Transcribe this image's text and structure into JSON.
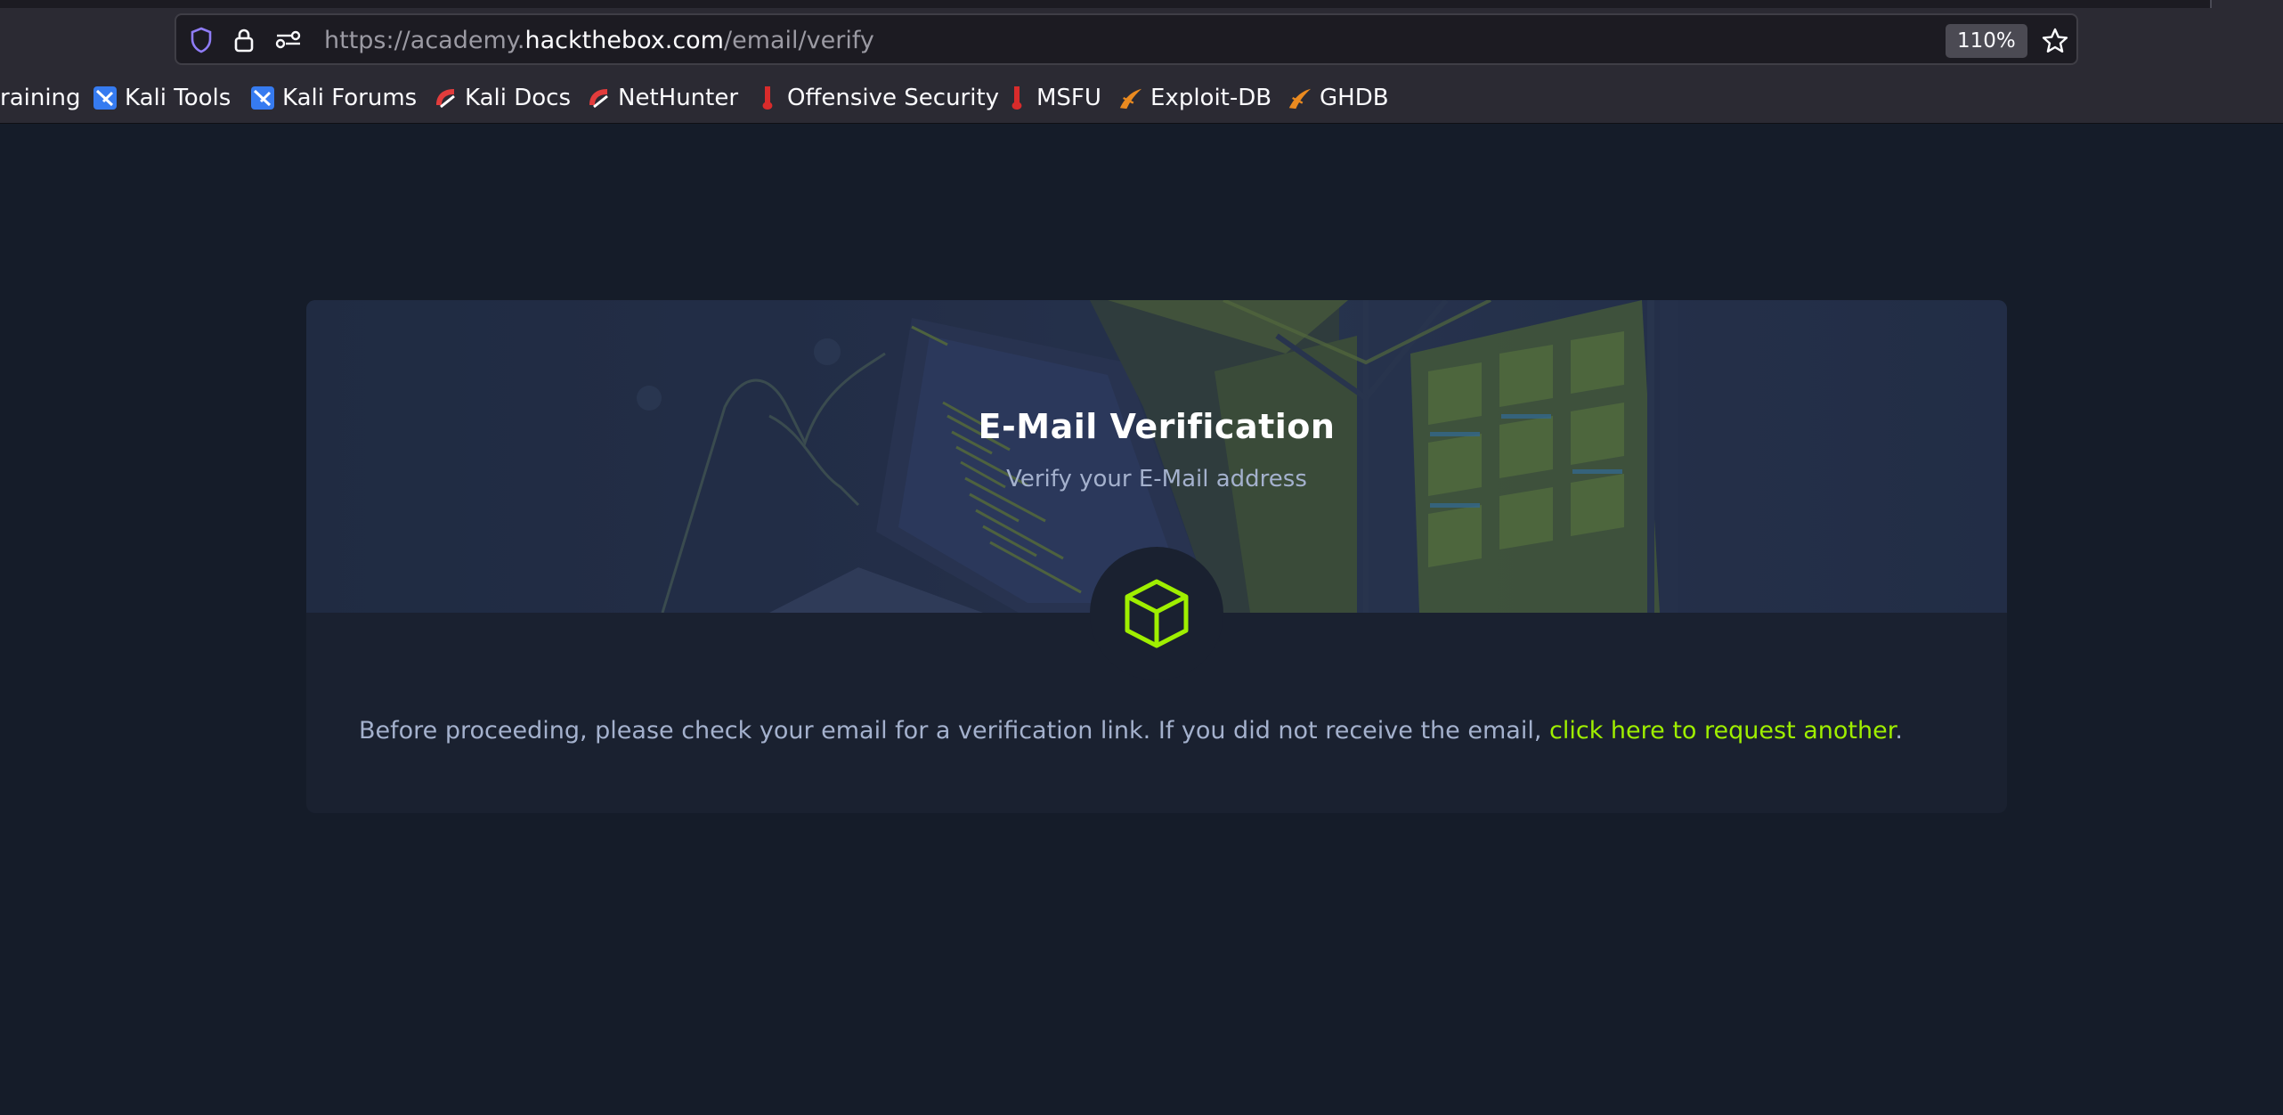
{
  "browser": {
    "url_prefix": "https://academy.",
    "url_host": "hackthebox.com",
    "url_path": "/email/verify",
    "zoom": "110%",
    "bookmarks": [
      {
        "label": "raining",
        "icon": "none"
      },
      {
        "label": "Kali Tools",
        "icon": "kali-dragon-icon"
      },
      {
        "label": "Kali Forums",
        "icon": "kali-dragon-icon"
      },
      {
        "label": "Kali Docs",
        "icon": "kali-docs-icon"
      },
      {
        "label": "NetHunter",
        "icon": "kali-docs-icon"
      },
      {
        "label": "Offensive Security",
        "icon": "offsec-icon"
      },
      {
        "label": "MSFU",
        "icon": "offsec-icon"
      },
      {
        "label": "Exploit-DB",
        "icon": "exploit-db-icon"
      },
      {
        "label": "GHDB",
        "icon": "exploit-db-icon"
      }
    ]
  },
  "card": {
    "title": "E-Mail Verification",
    "subtitle": "Verify your E-Mail address",
    "icon": "cube-icon",
    "message_before": "Before proceeding, please check your email for a verification link. If you did not receive the email, ",
    "link_text": "click here to request another",
    "message_after": "."
  },
  "colors": {
    "page_bg": "#151c29",
    "card_bg": "#1a2130",
    "accent": "#9fef00",
    "muted_text": "#a4b1cd"
  }
}
